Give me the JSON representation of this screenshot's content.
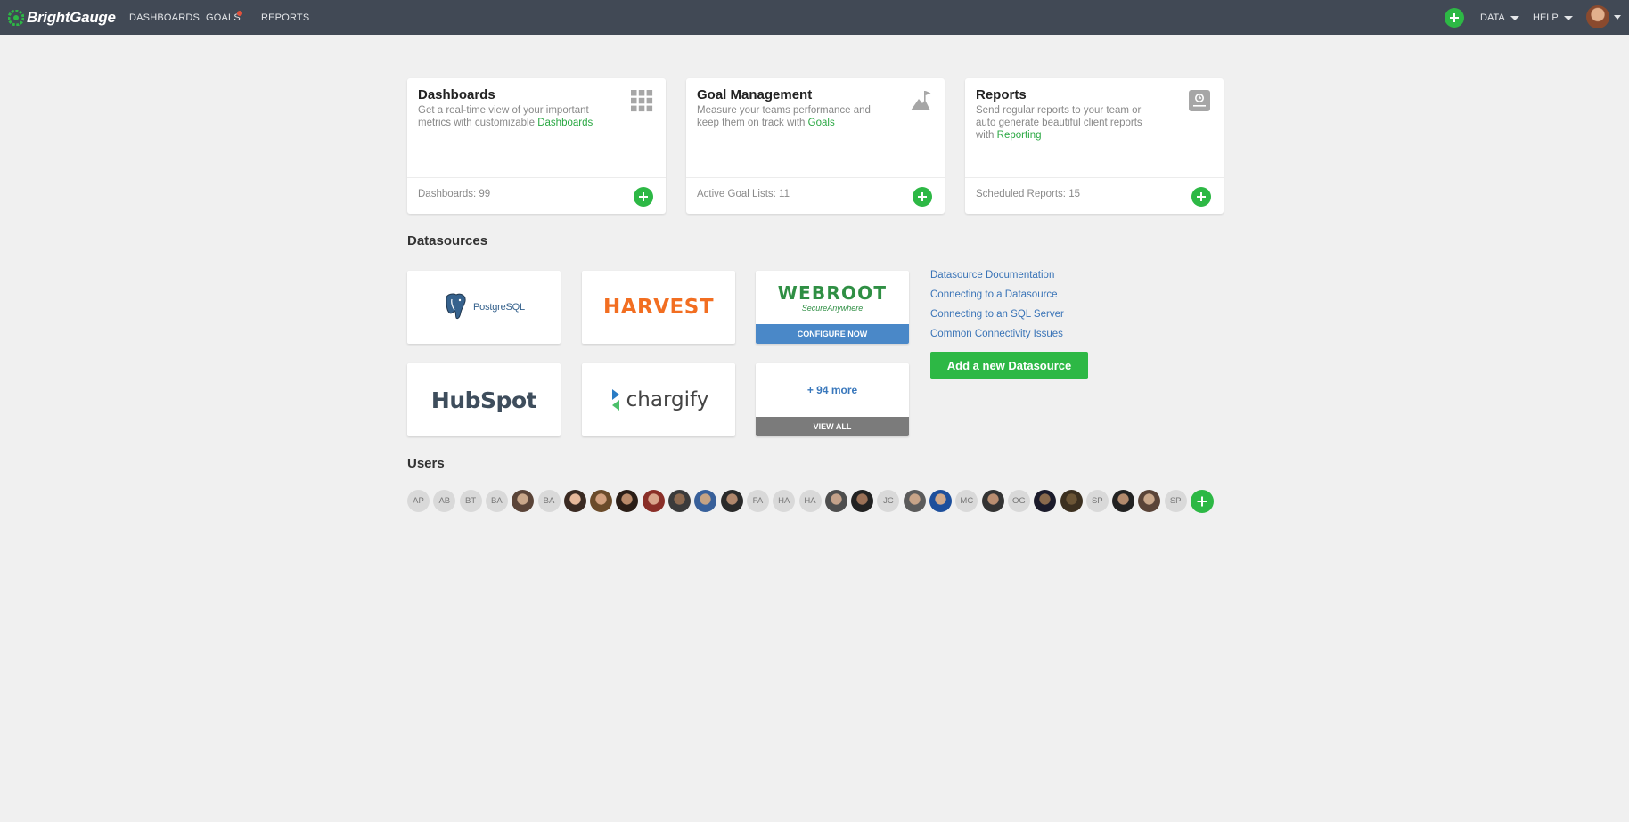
{
  "brand": {
    "name": "BrightGauge"
  },
  "nav": {
    "dashboards": "DASHBOARDS",
    "goals": "GOALS",
    "reports": "REPORTS",
    "data": "DATA",
    "help": "HELP"
  },
  "cards": [
    {
      "title": "Dashboards",
      "desc": "Get a real-time view of your important metrics with customizable ",
      "link": "Dashboards",
      "count": "Dashboards: 99",
      "icon": "grid-icon"
    },
    {
      "title": "Goal Management",
      "desc": "Measure your teams performance and keep them on track with ",
      "link": "Goals",
      "count": "Active Goal Lists: 11",
      "icon": "mountain-flag-icon"
    },
    {
      "title": "Reports",
      "desc": "Send regular reports to your team or auto generate beautiful client reports with ",
      "link": "Reporting",
      "count": "Scheduled Reports: 15",
      "icon": "report-icon"
    }
  ],
  "datasources": {
    "heading": "Datasources",
    "tiles": {
      "postgres": "PostgreSQL",
      "harvest": "HARVEST",
      "webroot": "WEBROOT",
      "webroot_sub": "SecureAnywhere",
      "webroot_cta": "CONFIGURE NOW",
      "hubspot": "HubSpot",
      "chargify": "chargify",
      "more": "+ 94 more",
      "more_cta": "VIEW ALL"
    },
    "links": [
      "Datasource Documentation",
      "Connecting to a Datasource",
      "Connecting to an SQL Server",
      "Common Connectivity Issues"
    ],
    "add_button": "Add a new Datasource"
  },
  "users": {
    "heading": "Users",
    "members": [
      "AP",
      "AB",
      "BT",
      "BA",
      "",
      "BA",
      "",
      "",
      "",
      "",
      "",
      "",
      "",
      "FA",
      "HA",
      "HA",
      "",
      "",
      "JC",
      "",
      "",
      "MC",
      "",
      "OG",
      "",
      "",
      "SP",
      "",
      "",
      "SP"
    ]
  },
  "colors": {
    "nav_bg": "#414955",
    "accent_green": "#2db845",
    "link_blue": "#3a74b7",
    "webroot_bar": "#4a88c8",
    "viewall_bar": "#7b7b7b"
  }
}
